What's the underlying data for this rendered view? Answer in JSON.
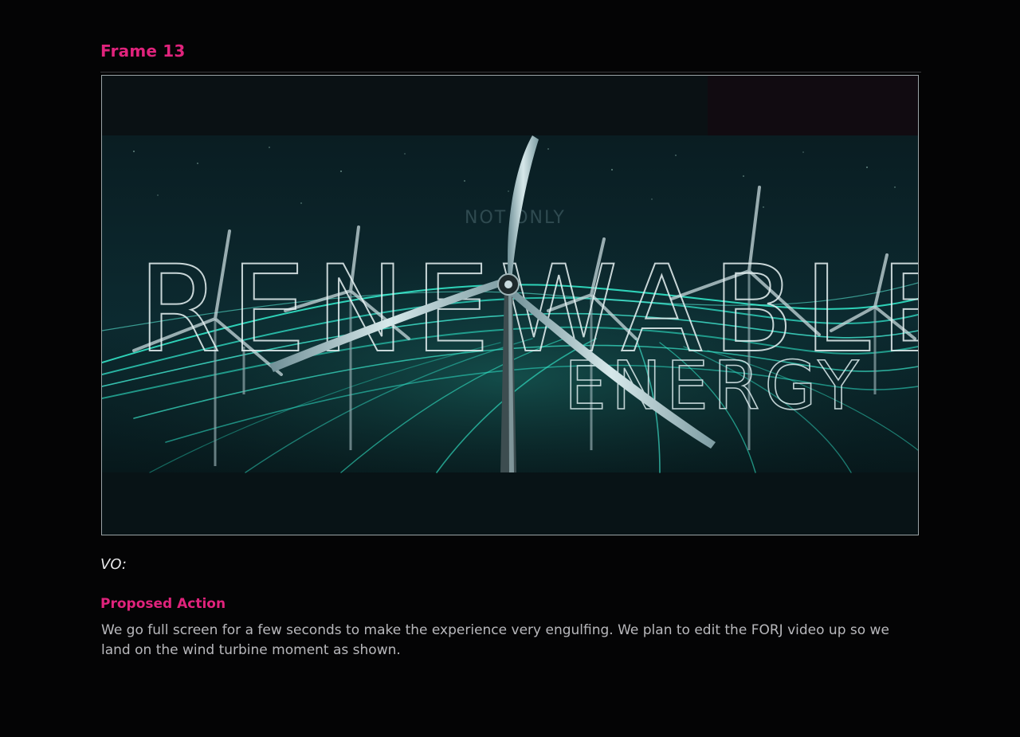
{
  "frame": {
    "title": "Frame 13"
  },
  "storyboard_image": {
    "headline": "RENEWABLE",
    "subheadline": "ENERGY",
    "faint_text": "NOT ONLY"
  },
  "vo": {
    "label": "VO:"
  },
  "proposed_action": {
    "title": "Proposed Action",
    "body": "We go full screen for a few seconds to make the experience very engulfing. We plan to edit the FORJ video up so we land on the wind turbine moment as shown."
  },
  "colors": {
    "accent": "#e0237c",
    "background": "#040405",
    "glow": "#35f0d0",
    "body_text": "#b8b8bc"
  }
}
